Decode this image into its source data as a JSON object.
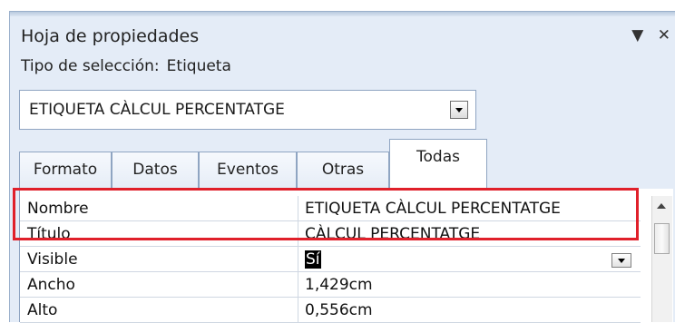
{
  "window": {
    "title": "Hoja de propiedades",
    "dropdown_glyph": "▼",
    "close_glyph": "✕"
  },
  "selection": {
    "type_label": "Tipo de selección:",
    "type_value": "Etiqueta",
    "object_name": "ETIQUETA CÀLCUL PERCENTATGE"
  },
  "tabs": [
    {
      "label": "Formato",
      "active": false
    },
    {
      "label": "Datos",
      "active": false
    },
    {
      "label": "Eventos",
      "active": false
    },
    {
      "label": "Otras",
      "active": false
    },
    {
      "label": "Todas",
      "active": true
    }
  ],
  "properties": [
    {
      "name": "Nombre",
      "value": "ETIQUETA CÀLCUL PERCENTATGE"
    },
    {
      "name": "Título",
      "value": "CÀLCUL PERCENTATGE"
    },
    {
      "name": "Visible",
      "value": "Sí"
    },
    {
      "name": "Ancho",
      "value": "1,429cm"
    },
    {
      "name": "Alto",
      "value": "0,556cm"
    }
  ],
  "colors": {
    "highlight_box": "#e0202a",
    "panel_background": "#e4ecf7",
    "border": "#8fa5c2"
  }
}
